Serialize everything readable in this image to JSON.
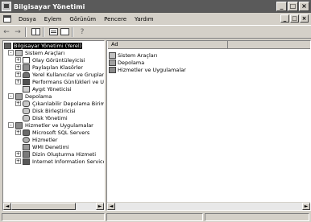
{
  "window": {
    "title": "Bilgisayar Yönetimi"
  },
  "title_buttons": {
    "minimize": "_",
    "maximize": "□",
    "close": "×"
  },
  "menu": {
    "items": [
      "Dosya",
      "Eylem",
      "Görünüm",
      "Pencere",
      "Yardım"
    ],
    "mdi_buttons": {
      "minimize": "_",
      "restore": "□",
      "close": "×"
    }
  },
  "toolbar": {
    "back": "←",
    "forward": "→",
    "help": "?"
  },
  "tree": {
    "root": "Bilgisayar Yönetimi (Yerel)",
    "items": [
      {
        "label": "Sistem Araçları",
        "expander": "-"
      },
      {
        "label": "Olay Görüntüleyicisi",
        "expander": "+"
      },
      {
        "label": "Paylaşılan Klasörler",
        "expander": "+"
      },
      {
        "label": "Yerel Kullanıcılar ve Gruplar",
        "expander": "+"
      },
      {
        "label": "Performans Günlükleri ve Uyarılar",
        "expander": "+"
      },
      {
        "label": "Aygıt Yöneticisi",
        "expander": ""
      },
      {
        "label": "Depolama",
        "expander": "-"
      },
      {
        "label": "Çıkarılabilir Depolama Birimi",
        "expander": "+"
      },
      {
        "label": "Disk Birleştiricisi",
        "expander": ""
      },
      {
        "label": "Disk Yönetimi",
        "expander": ""
      },
      {
        "label": "Hizmetler ve Uygulamalar",
        "expander": "-"
      },
      {
        "label": "Microsoft SQL Servers",
        "expander": "+"
      },
      {
        "label": "Hizmetler",
        "expander": ""
      },
      {
        "label": "WMI Denetimi",
        "expander": ""
      },
      {
        "label": "Dizin Oluşturma Hizmeti",
        "expander": "+"
      },
      {
        "label": "Internet Information Services",
        "expander": "+"
      }
    ]
  },
  "list": {
    "column_header": "Ad",
    "rows": [
      "Sistem Araçları",
      "Depolama",
      "Hizmetler ve Uygulamalar"
    ]
  },
  "scroll": {
    "left": "◄",
    "right": "►"
  }
}
